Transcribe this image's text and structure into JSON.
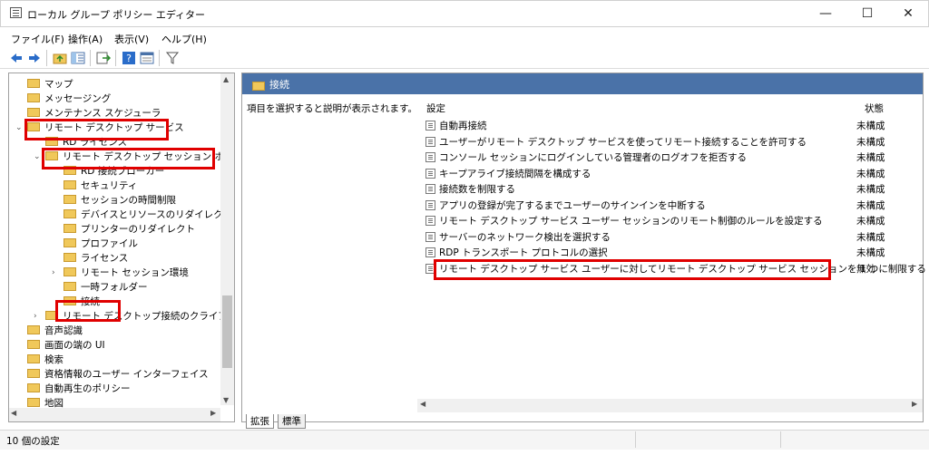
{
  "window": {
    "title": "ローカル グループ ポリシー エディター",
    "minimize": "—",
    "maximize": "☐",
    "close": "✕"
  },
  "menu": [
    "ファイル(F)",
    "操作(A)",
    "表示(V)",
    "ヘルプ(H)"
  ],
  "toolbar": [
    "back-icon",
    "forward-icon",
    "up-folder-icon",
    "show-hide-tree-icon",
    "export-list-icon",
    "help-icon",
    "properties-icon",
    "filter-icon"
  ],
  "tree": [
    {
      "label": "マップ"
    },
    {
      "label": "メッセージング"
    },
    {
      "label": "メンテナンス スケジューラ"
    },
    {
      "label": "リモート デスクトップ サービス",
      "twisty": "⌄"
    },
    {
      "label": "RD ライセンス"
    },
    {
      "label": "リモート デスクトップ セッション ホスト",
      "twisty": "⌄"
    },
    {
      "label": "RD 接続ブローカー"
    },
    {
      "label": "セキュリティ"
    },
    {
      "label": "セッションの時間制限"
    },
    {
      "label": "デバイスとリソースのリダイレクト"
    },
    {
      "label": "プリンターのリダイレクト"
    },
    {
      "label": "プロファイル"
    },
    {
      "label": "ライセンス"
    },
    {
      "label": "リモート セッション環境",
      "twisty": "›"
    },
    {
      "label": "一時フォルダー"
    },
    {
      "label": "接続"
    },
    {
      "label": "リモート デスクトップ接続のクライアント",
      "twisty": "›"
    },
    {
      "label": "音声認識"
    },
    {
      "label": "画面の端の UI"
    },
    {
      "label": "検索"
    },
    {
      "label": "資格情報のユーザー インターフェイス"
    },
    {
      "label": "自動再生のポリシー"
    },
    {
      "label": "地図"
    }
  ],
  "right": {
    "header": "接続",
    "description": "項目を選択すると説明が表示されます。",
    "col_setting": "設定",
    "col_state": "状態",
    "rows": [
      {
        "label": "自動再接続",
        "state": "未構成"
      },
      {
        "label": "ユーザーがリモート デスクトップ サービスを使ってリモート接続することを許可する",
        "state": "未構成"
      },
      {
        "label": "コンソール セッションにログインしている管理者のログオフを拒否する",
        "state": "未構成"
      },
      {
        "label": "キープアライブ接続間隔を構成する",
        "state": "未構成"
      },
      {
        "label": "接続数を制限する",
        "state": "未構成"
      },
      {
        "label": "アプリの登録が完了するまでユーザーのサインインを中断する",
        "state": "未構成"
      },
      {
        "label": "リモート デスクトップ サービス ユーザー セッションのリモート制御のルールを設定する",
        "state": "未構成"
      },
      {
        "label": "サーバーのネットワーク検出を選択する",
        "state": "未構成"
      },
      {
        "label": "RDP トランスポート プロトコルの選択",
        "state": "未構成"
      },
      {
        "label": "リモート デスクトップ サービス ユーザーに対してリモート デスクトップ サービス セッションを 1 つに制限する",
        "state": "無効"
      }
    ]
  },
  "tabs": [
    "拡張",
    "標準"
  ],
  "status": "10 個の設定",
  "colors": {
    "header": "#4a72a8",
    "highlight": "#e00000"
  }
}
